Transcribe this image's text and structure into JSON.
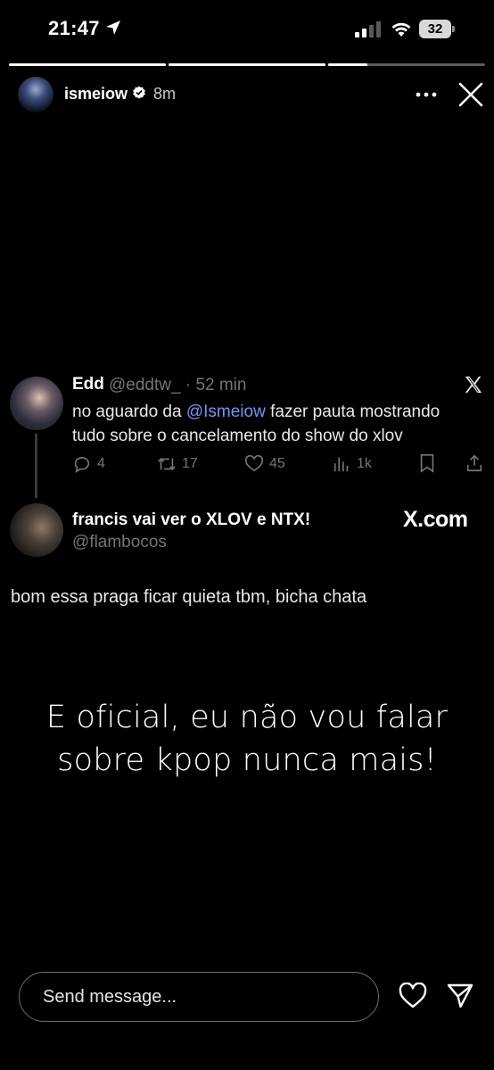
{
  "status_bar": {
    "time": "21:47",
    "battery": "32",
    "icons": [
      "location-arrow-icon",
      "cellular-signal-icon",
      "wifi-icon",
      "battery-icon"
    ]
  },
  "story": {
    "progress": [
      1.0,
      1.0,
      0.25
    ],
    "author": "ismeiow",
    "verified": true,
    "time": "8m",
    "caption_line1": "E oficial, eu não vou falar",
    "caption_line2": "sobre kpop nunca mais!"
  },
  "tweet": {
    "name": "Edd",
    "handle": "@eddtw_ · 52 min",
    "text_before": "no aguardo da ",
    "mention": "@Ismeiow",
    "text_after": " fazer pauta mostrando tudo sobre o cancelamento do show do xlov",
    "replies": "4",
    "retweets": "17",
    "likes": "45",
    "views": "1k"
  },
  "quoted": {
    "name": "francis vai ver o XLOV e NTX!",
    "handle": "@flambocos",
    "source": "X.com",
    "text": "bom essa praga ficar quieta tbm, bicha chata"
  },
  "footer": {
    "message_placeholder": "Send message..."
  },
  "colors": {
    "background": "#000000",
    "mention": "#7a93f5",
    "muted": "#71767b"
  }
}
